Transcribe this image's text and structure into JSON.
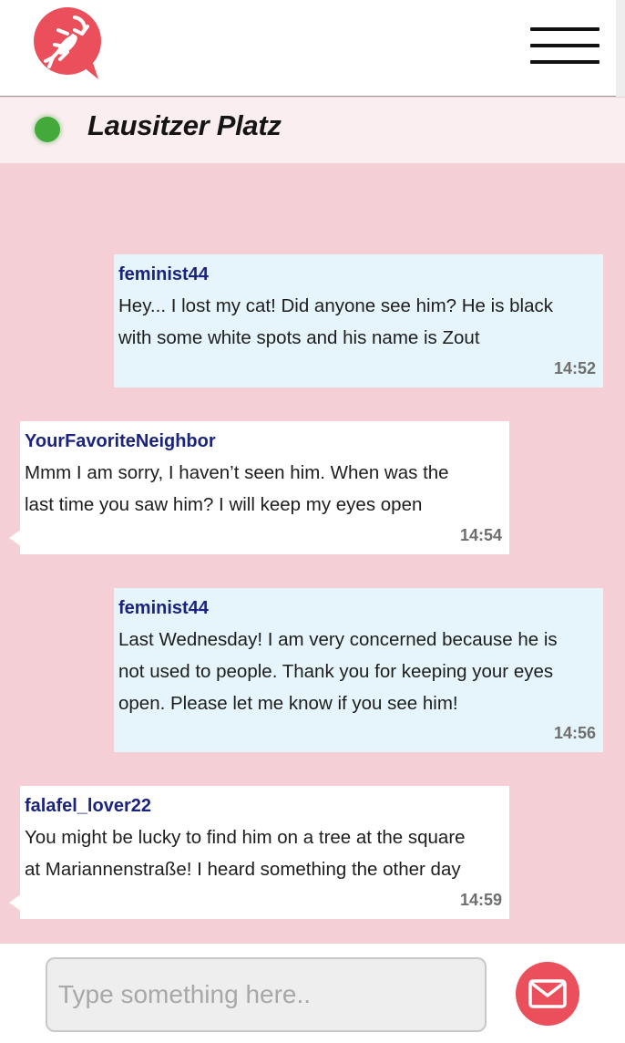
{
  "app": {
    "logo_icon": "lobster-chat-bubble-icon",
    "menu_icon": "hamburger-menu-icon",
    "brand_color": "#ea4f5b"
  },
  "room": {
    "title": "Lausitzer Platz",
    "status": "online",
    "status_color": "#43a93b"
  },
  "messages": [
    {
      "username": "feminist44",
      "lines": [
        "Hey... I lost my cat! Did anyone see him? He is black",
        "with some white spots and his name is Zout"
      ],
      "time": "14:52",
      "side": "right"
    },
    {
      "username": "YourFavoriteNeighbor",
      "lines": [
        "Mmm I am sorry, I haven’t seen him. When was the",
        "last time you saw him? I will keep my eyes open"
      ],
      "time": "14:54",
      "side": "left"
    },
    {
      "username": "feminist44",
      "lines": [
        "Last Wednesday! I am very concerned because he is",
        "not used to people. Thank you for keeping your eyes",
        "open. Please let me know if you see him!"
      ],
      "time": "14:56",
      "side": "right"
    },
    {
      "username": "falafel_lover22",
      "lines": [
        "You might be lucky to find him on a tree at the square",
        "at Mariannenstraße! I heard something the other day"
      ],
      "time": "14:59",
      "side": "left"
    }
  ],
  "composer": {
    "placeholder": "Type something here..",
    "value": "",
    "send_icon": "envelope-icon"
  }
}
